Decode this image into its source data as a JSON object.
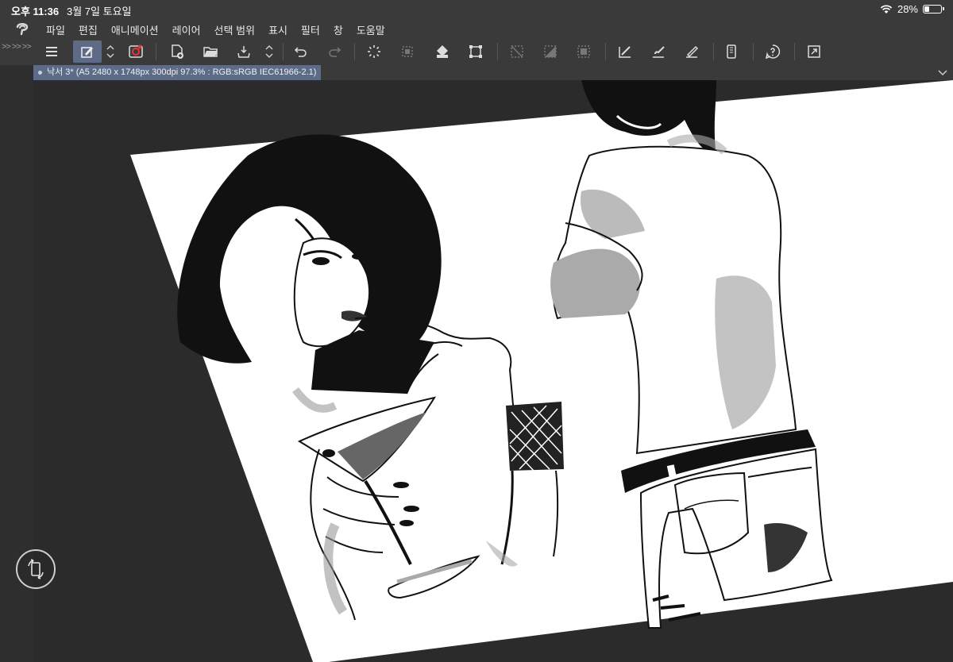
{
  "status": {
    "time": "오후 11:36",
    "date": "3월 7일 토요일",
    "battery": "28%",
    "battery_level": 0.28
  },
  "menu": {
    "items": [
      "파일",
      "편집",
      "애니메이션",
      "레이어",
      "선택 범위",
      "표시",
      "필터",
      "창",
      "도움말"
    ]
  },
  "toolbar": {
    "icons": [
      "menu-icon",
      "pen-settings-icon",
      "up-down-arrows-icon",
      "clip-logo-icon",
      "new-canvas-icon",
      "open-folder-icon",
      "save-icon",
      "up-down-arrows-icon",
      "undo-icon",
      "redo-icon",
      "loading-spinner-icon",
      "clear-selection-icon",
      "fill-icon",
      "transform-icon",
      "deselect-icon",
      "invert-selection-icon",
      "select-layer-icon",
      "draw-pen-icon",
      "brush-icon",
      "eraser-icon",
      "smartphone-icon",
      "help-icon",
      "fullscreen-icon"
    ]
  },
  "tab": {
    "title": "낙서 3* (A5 2480 x 1748px 300dpi 97.3% : RGB:sRGB IEC61966-2.1)"
  },
  "colors": {
    "accent": "#5d6b86",
    "background": "#3a3a3a",
    "canvas_bg": "#2b2b2b",
    "paper": "#ffffff"
  }
}
